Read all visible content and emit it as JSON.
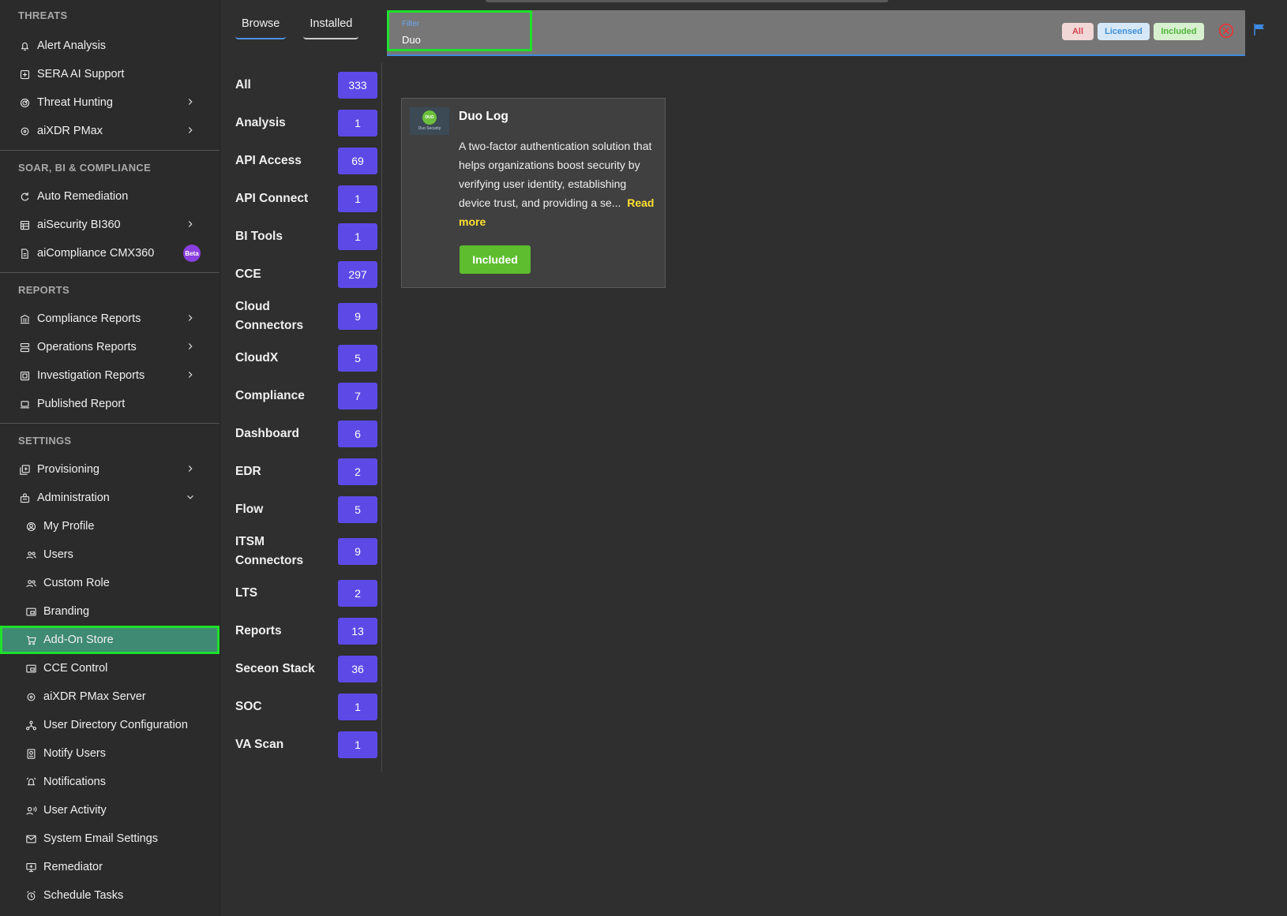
{
  "sidebar": {
    "threats": {
      "title": "THREATS",
      "items": [
        {
          "label": "Alert Analysis",
          "icon": "bell-icon"
        },
        {
          "label": "SERA AI Support",
          "icon": "plus-square-icon"
        },
        {
          "label": "Threat Hunting",
          "icon": "radar-icon"
        },
        {
          "label": "aiXDR PMax",
          "icon": "target-icon"
        }
      ]
    },
    "soar": {
      "title": "SOAR, BI & COMPLIANCE",
      "items": [
        {
          "label": "Auto Remediation",
          "icon": "refresh-icon"
        },
        {
          "label": "aiSecurity BI360",
          "icon": "table-icon"
        },
        {
          "label": "aiCompliance CMX360",
          "icon": "document-icon",
          "badge": "Beta"
        }
      ]
    },
    "reports": {
      "title": "REPORTS",
      "items": [
        {
          "label": "Compliance Reports",
          "icon": "bank-icon"
        },
        {
          "label": "Operations Reports",
          "icon": "server-icon"
        },
        {
          "label": "Investigation Reports",
          "icon": "frame-icon"
        },
        {
          "label": "Published Report",
          "icon": "laptop-icon"
        }
      ]
    },
    "settings": {
      "title": "SETTINGS",
      "items": [
        {
          "label": "Provisioning",
          "icon": "library-add-icon"
        },
        {
          "label": "Administration",
          "icon": "admin-icon"
        },
        {
          "label": "My Profile",
          "icon": "profile-icon"
        },
        {
          "label": "Users",
          "icon": "users-icon"
        },
        {
          "label": "Custom Role",
          "icon": "users-icon"
        },
        {
          "label": "Branding",
          "icon": "picture-in-picture-icon"
        },
        {
          "label": "Add-On Store",
          "icon": "cart-icon"
        },
        {
          "label": "CCE Control",
          "icon": "picture-in-picture-icon"
        },
        {
          "label": "aiXDR PMax Server",
          "icon": "target-icon"
        },
        {
          "label": "User Directory Configuration",
          "icon": "hub-icon"
        },
        {
          "label": "Notify Users",
          "icon": "badge-icon"
        },
        {
          "label": "Notifications",
          "icon": "alarm-icon"
        },
        {
          "label": "User Activity",
          "icon": "voice-user-icon"
        },
        {
          "label": "System Email Settings",
          "icon": "mail-icon"
        },
        {
          "label": "Remediator",
          "icon": "monitor-add-icon"
        },
        {
          "label": "Schedule Tasks",
          "icon": "clock-icon"
        }
      ]
    }
  },
  "tabs": {
    "browse": "Browse",
    "installed": "Installed"
  },
  "categories": [
    {
      "label": "All",
      "count": "333"
    },
    {
      "label": "Analysis",
      "count": "1"
    },
    {
      "label": "API Access",
      "count": "69"
    },
    {
      "label": "API Connect",
      "count": "1"
    },
    {
      "label": "BI Tools",
      "count": "1"
    },
    {
      "label": "CCE",
      "count": "297"
    },
    {
      "label": "Cloud Connectors",
      "count": "9"
    },
    {
      "label": "CloudX",
      "count": "5"
    },
    {
      "label": "Compliance",
      "count": "7"
    },
    {
      "label": "Dashboard",
      "count": "6"
    },
    {
      "label": "EDR",
      "count": "2"
    },
    {
      "label": "Flow",
      "count": "5"
    },
    {
      "label": "ITSM Connectors",
      "count": "9"
    },
    {
      "label": "LTS",
      "count": "2"
    },
    {
      "label": "Reports",
      "count": "13"
    },
    {
      "label": "Seceon Stack",
      "count": "36"
    },
    {
      "label": "SOC",
      "count": "1"
    },
    {
      "label": "VA Scan",
      "count": "1"
    }
  ],
  "filter": {
    "label": "Filter",
    "value": "Duo",
    "chips": {
      "all": "All",
      "licensed": "Licensed",
      "included": "Included"
    }
  },
  "card": {
    "title": "Duo Log",
    "thumb_logo": "DUO",
    "thumb_caption": "Duo Security",
    "description": "A two-factor authentication solution that helps organizations boost security by verifying user identity, establishing device trust, and providing a se...",
    "read_more": "Read more",
    "status_button": "Included"
  },
  "colors": {
    "accent_badge": "#5d4ae6",
    "active_item": "#3f8a72",
    "highlight": "#1fe02c",
    "included": "#5ebd2e",
    "read_more": "#ffe033"
  }
}
